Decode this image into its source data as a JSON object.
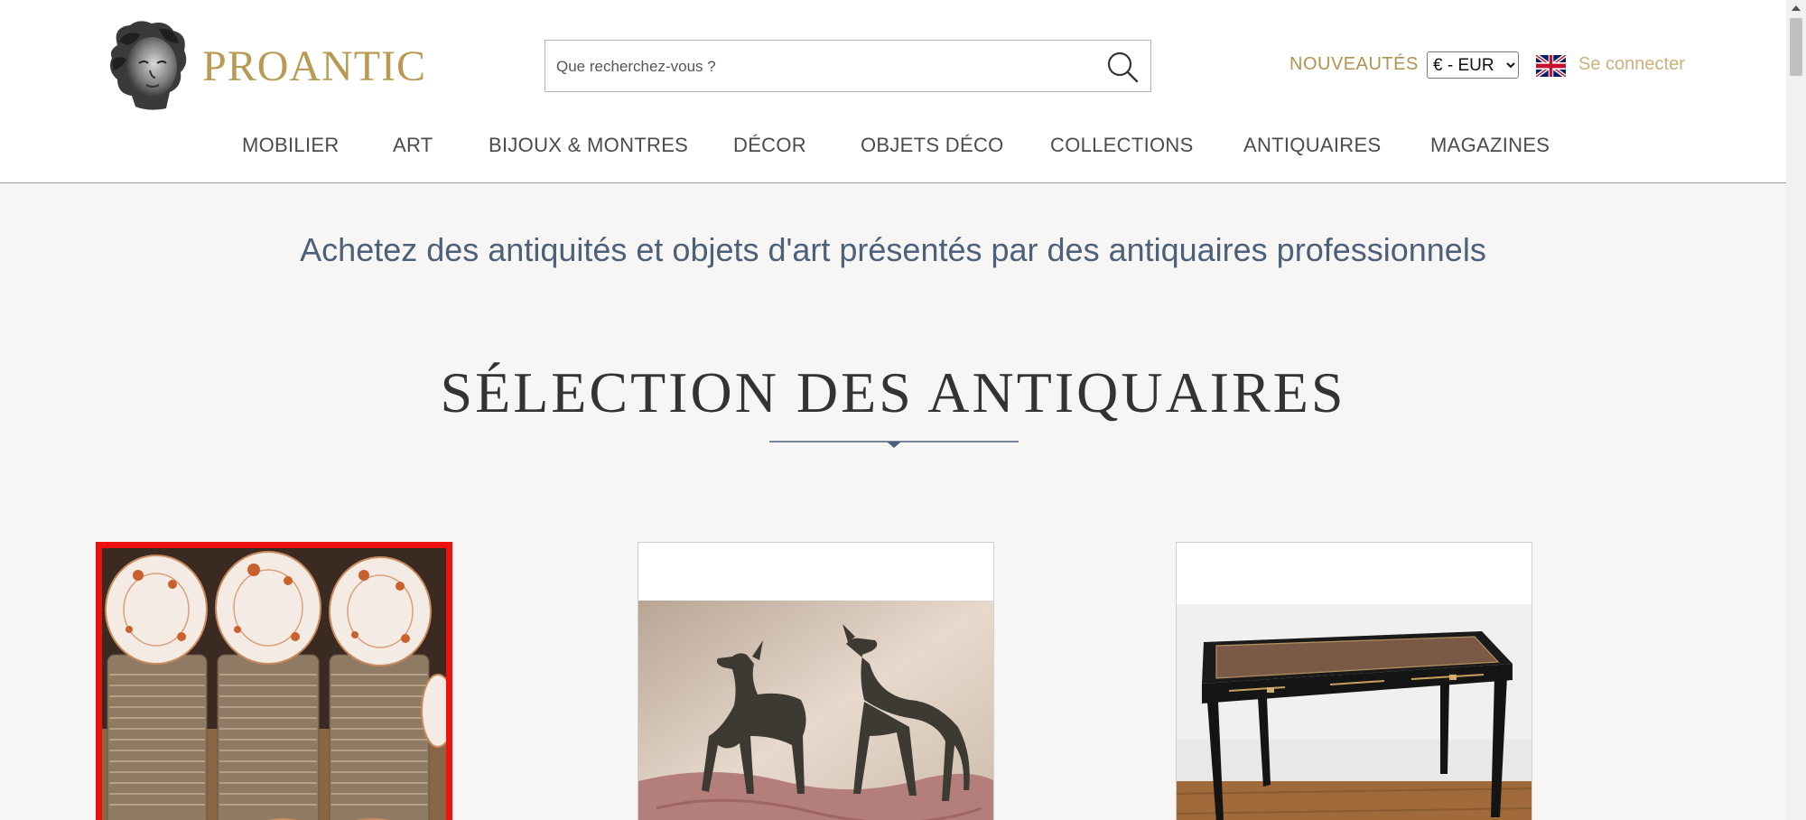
{
  "brand": {
    "name": "PROANTIC"
  },
  "search": {
    "placeholder": "Que recherchez-vous ?"
  },
  "header": {
    "new_label": "NOUVEAUTÉS",
    "currency_selected": "€ - EUR",
    "login_label": "Se connecter",
    "language_icon": "uk-flag-icon"
  },
  "nav": {
    "items": [
      {
        "label": "MOBILIER"
      },
      {
        "label": "ART"
      },
      {
        "label": "BIJOUX & MONTRES"
      },
      {
        "label": "DÉCOR"
      },
      {
        "label": "OBJETS DÉCO"
      },
      {
        "label": "COLLECTIONS"
      },
      {
        "label": "ANTIQUAIRES"
      },
      {
        "label": "MAGAZINES"
      }
    ]
  },
  "hero": {
    "tagline": "Achetez des antiquités et objets d'art présentés par des antiquaires professionnels",
    "section_title": "SÉLECTION DES ANTIQUAIRES"
  },
  "colors": {
    "brand_gold": "#b99a55",
    "link_gold": "#b59150",
    "tagline_blue": "#4c607a",
    "selection_red": "#ee1111"
  },
  "cards": [
    {
      "subject": "porcelain-plates-stack",
      "selected": true
    },
    {
      "subject": "bronze-greyhounds-pair",
      "selected": false
    },
    {
      "subject": "black-desk-leather-top",
      "selected": false
    }
  ]
}
